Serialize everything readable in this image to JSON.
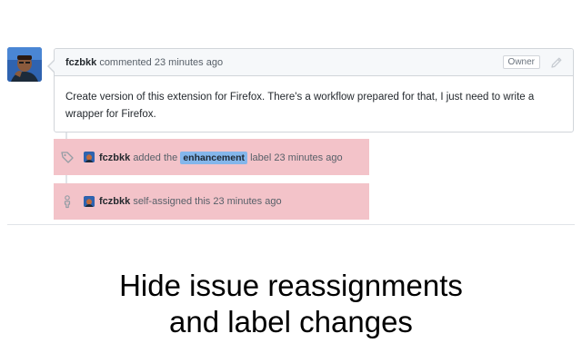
{
  "comment": {
    "author": "fczbkk",
    "action": "commented",
    "time": "23 minutes ago",
    "badge": "Owner",
    "body": "Create version of this extension for Firefox. There's a workflow prepared for that, I just need to write a wrapper for Firefox."
  },
  "events": [
    {
      "icon": "tag-icon",
      "author": "fczbkk",
      "pre": "added the",
      "label": "enhancement",
      "post": "label 23 minutes ago"
    },
    {
      "icon": "person-icon",
      "author": "fczbkk",
      "text": "self-assigned this 23 minutes ago"
    }
  ],
  "caption": {
    "line1": "Hide issue reassignments",
    "line2": "and label changes"
  },
  "colors": {
    "highlight": "#f3c3c9",
    "label_bg": "#84b6eb",
    "border": "#d1d5da",
    "header_bg": "#f6f8fa"
  }
}
